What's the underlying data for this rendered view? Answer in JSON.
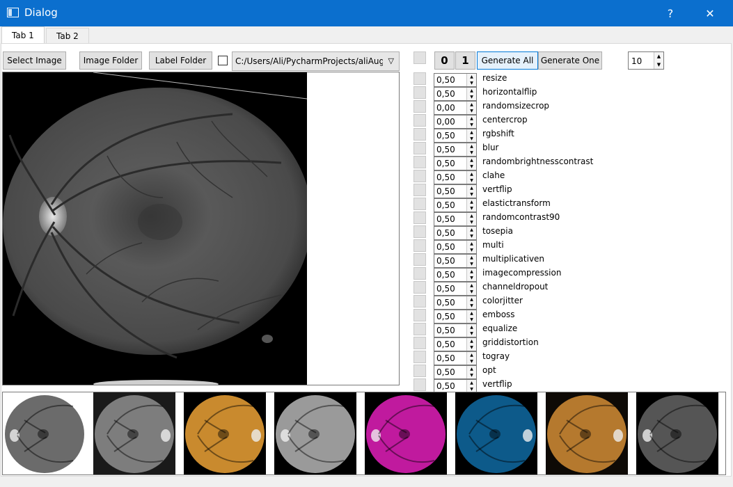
{
  "window": {
    "title": "Dialog",
    "help_label": "?",
    "close_label": "✕"
  },
  "tabs": [
    {
      "label": "Tab 1",
      "active": true
    },
    {
      "label": "Tab 2",
      "active": false
    }
  ],
  "toolbar": {
    "select_image_label": "Select Image",
    "image_folder_label": "Image Folder",
    "label_folder_label": "Label Folder",
    "path_value": "C:/Users/Ali/PycharmProjects/aliAugr"
  },
  "controls": {
    "zero_label": "0",
    "one_label": "1",
    "generate_all_label": "Generate All",
    "generate_one_label": "Generate One",
    "count_value": "10"
  },
  "augmentations": [
    {
      "name": "resize",
      "prob": "0,50"
    },
    {
      "name": "horizontalflip",
      "prob": "0,50"
    },
    {
      "name": "randomsizecrop",
      "prob": "0,00"
    },
    {
      "name": "centercrop",
      "prob": "0,00"
    },
    {
      "name": "rgbshift",
      "prob": "0,50"
    },
    {
      "name": "blur",
      "prob": "0,50"
    },
    {
      "name": "randombrightnesscontrast",
      "prob": "0,50"
    },
    {
      "name": "clahe",
      "prob": "0,50"
    },
    {
      "name": "vertflip",
      "prob": "0,50"
    },
    {
      "name": "elastictransform",
      "prob": "0,50"
    },
    {
      "name": "randomcontrast90",
      "prob": "0,50"
    },
    {
      "name": "tosepia",
      "prob": "0,50"
    },
    {
      "name": "multi",
      "prob": "0,50"
    },
    {
      "name": "multiplicativen",
      "prob": "0,50"
    },
    {
      "name": "imagecompression",
      "prob": "0,50"
    },
    {
      "name": "channeldropout",
      "prob": "0,50"
    },
    {
      "name": "colorjitter",
      "prob": "0,50"
    },
    {
      "name": "emboss",
      "prob": "0,50"
    },
    {
      "name": "equalize",
      "prob": "0,50"
    },
    {
      "name": "griddistortion",
      "prob": "0,50"
    },
    {
      "name": "togray",
      "prob": "0,50"
    },
    {
      "name": "opt",
      "prob": "0,50"
    },
    {
      "name": "vertflip",
      "prob": "0,50"
    }
  ],
  "thumbnails": [
    {
      "kind": "high-contrast-gray",
      "bg": "#ffffff",
      "fg": "#6b6b6b"
    },
    {
      "kind": "gray-rotated",
      "bg": "#1a1a1a",
      "fg": "#7d7d7d"
    },
    {
      "kind": "color-original",
      "bg": "#000000",
      "fg": "#c98a2e"
    },
    {
      "kind": "clahe-gray",
      "bg": "#000000",
      "fg": "#9a9a9a"
    },
    {
      "kind": "magenta-shift",
      "bg": "#000000",
      "fg": "#c01a9e"
    },
    {
      "kind": "blue-shift",
      "bg": "#000000",
      "fg": "#0d5a8a"
    },
    {
      "kind": "sepia-elastic",
      "bg": "#0e0a06",
      "fg": "#b5792e"
    },
    {
      "kind": "gray-dark",
      "bg": "#000000",
      "fg": "#555555"
    }
  ],
  "colors": {
    "title_bar": "#0b6fce",
    "focus_border": "#0078d7"
  }
}
